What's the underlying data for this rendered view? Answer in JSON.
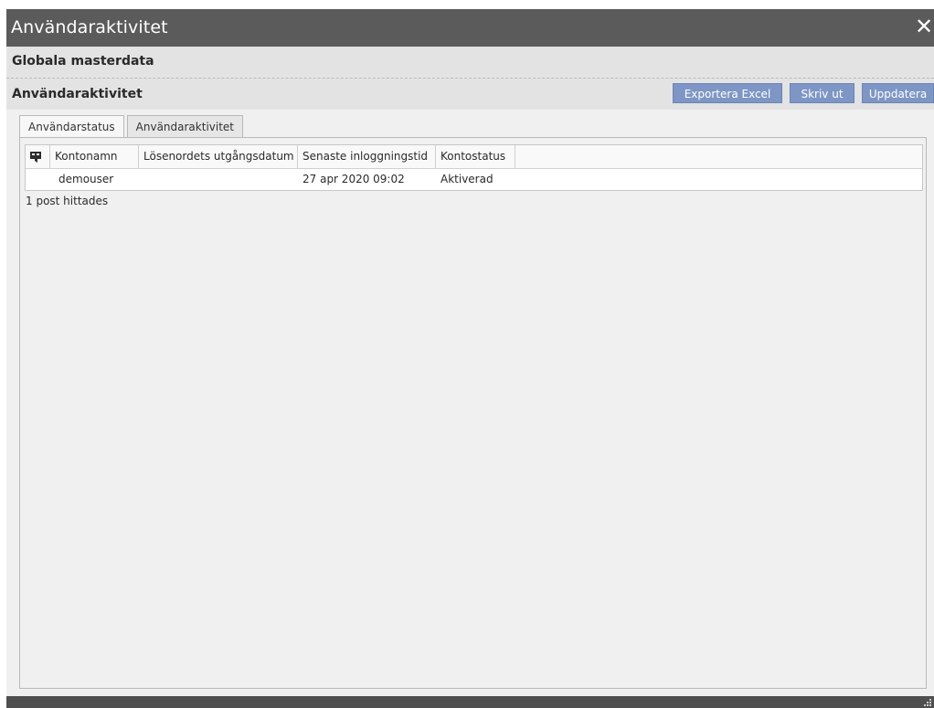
{
  "window": {
    "title": "Användaraktivitet",
    "close_icon": "close-icon"
  },
  "header": {
    "section_label": "Globala masterdata",
    "subsection_label": "Användaraktivitet"
  },
  "toolbar": {
    "export_label": "Exportera Excel",
    "print_label": "Skriv ut",
    "update_label": "Uppdatera"
  },
  "tabs": [
    {
      "label": "Användarstatus",
      "active": true
    },
    {
      "label": "Användaraktivitet",
      "active": false
    }
  ],
  "table": {
    "filter_icon": "filter-icon",
    "columns": [
      "Kontonamn",
      "Lösenordets utgångsdatum",
      "Senaste inloggningstid",
      "Kontostatus"
    ],
    "rows": [
      {
        "account": "demouser",
        "password_expiry": "",
        "last_login": "27 apr 2020 09:02",
        "status": "Aktiverad"
      }
    ],
    "result_count": "1 post hittades"
  },
  "colors": {
    "titlebar": "#5b5b5b",
    "button": "#7e96c6",
    "panel": "#f0f0f0"
  }
}
